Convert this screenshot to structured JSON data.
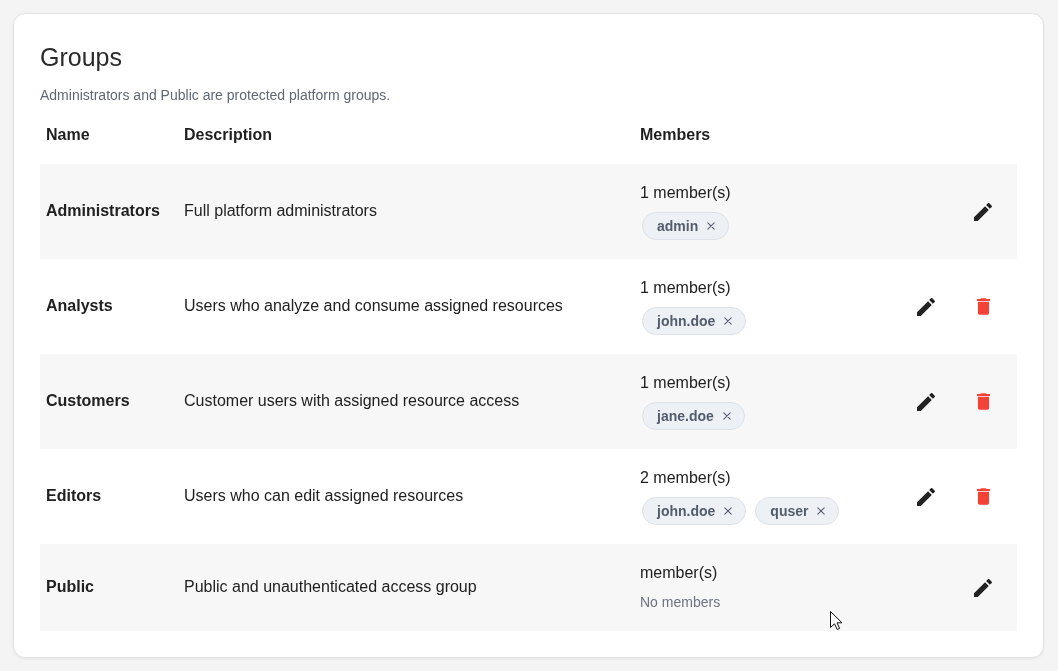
{
  "page": {
    "title": "Groups",
    "subtitle": "Administrators and Public are protected platform groups."
  },
  "table": {
    "columns": [
      "Name",
      "Description",
      "Members"
    ],
    "rows": [
      {
        "name": "Administrators",
        "description": "Full platform administrators",
        "member_count": "1 member(s)",
        "members": [
          "admin"
        ],
        "actions": [
          {
            "kind": "edit"
          }
        ]
      },
      {
        "name": "Analysts",
        "description": "Users who analyze and consume assigned resources",
        "member_count": "1 member(s)",
        "members": [
          "john.doe"
        ],
        "actions": [
          {
            "kind": "edit"
          },
          {
            "kind": "delete"
          }
        ]
      },
      {
        "name": "Customers",
        "description": "Customer users with assigned resource access",
        "member_count": "1 member(s)",
        "members": [
          "jane.doe"
        ],
        "actions": [
          {
            "kind": "edit"
          },
          {
            "kind": "delete"
          }
        ]
      },
      {
        "name": "Editors",
        "description": "Users who can edit assigned resources",
        "member_count": "2 member(s)",
        "members": [
          "john.doe",
          "quser"
        ],
        "actions": [
          {
            "kind": "edit"
          },
          {
            "kind": "delete"
          }
        ]
      },
      {
        "name": "Public",
        "description": "Public and unauthenticated access group",
        "member_count": "member(s)",
        "empty_text": "No members",
        "actions": [
          {
            "kind": "edit"
          }
        ]
      }
    ]
  }
}
